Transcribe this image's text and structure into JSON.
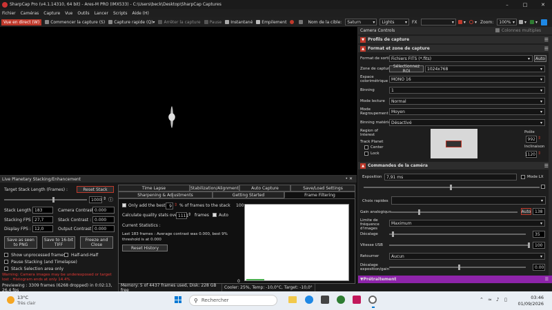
{
  "window": {
    "title": "SharpCap Pro (v4.1.14310, 64 bit) - Ares-M PRO (IMX533) - C:\\Users\\beck\\Desktop\\SharpCap Captures"
  },
  "menu": [
    "Fichier",
    "Caméras",
    "Capture",
    "Vue",
    "Outils",
    "Lancer",
    "Scripts",
    "Aide (H)"
  ],
  "toolbar": {
    "live": "Vue en direct (W)",
    "start_capture": "Commencer la capture (S)",
    "quick_capture": "Capture rapide (Q)",
    "stop_capture": "Arrêter la capture",
    "pause": "Pause",
    "snapshot": "Instantané",
    "stacking": "Empilement",
    "target_label": "Nom de la cible:",
    "target_value": "Saturn",
    "preset_value": "Lights",
    "fx_label": "FX",
    "zoom_label": "Zoom:",
    "zoom_value": "100%"
  },
  "lps": {
    "title": "Live Planetary Stacking/Enhancement",
    "target_stack_label": "Target Stack Length (Frames) :",
    "reset_stack": "Reset Stack",
    "target_stack_value": "1000",
    "stack_length_label": "Stack Length :",
    "stack_length_value": "183",
    "stacking_fps_label": "Stacking FPS :",
    "stacking_fps_value": "27,7",
    "display_fps_label": "Display FPS :",
    "display_fps_value": "12,0",
    "camera_contrast_label": "Camera Contrast :",
    "camera_contrast_value": "0.000",
    "stack_contrast_label": "Stack Contrast :",
    "stack_contrast_value": "0.000",
    "output_contrast_label": "Output Contrast :",
    "output_contrast_value": "0.000",
    "save_png": "Save as seen to PNG",
    "save_tiff": "Save to 16-bit TIFF",
    "freeze_close": "Freeze and Close",
    "show_unprocessed": "Show unprocessed frames",
    "half_and_half": "Half-and-Half",
    "pause_stacking": "Pause Stacking (and Timelapse)",
    "stack_selection": "Stack Selection area only",
    "warning": "Warning: Camera images may be underexposed or target lost - Histogram ends at only 14.4%",
    "tabs_row1": [
      "Time Lapse",
      "Stabilization/Alignment",
      "Auto Capture",
      "Save/Load Settings"
    ],
    "tabs_row2": [
      "Sharpening & Adjustments",
      "Getting Started",
      "Frame Filtering"
    ],
    "only_add_best": "Only add the best",
    "only_add_best_value": "9",
    "percent_frames": "% of frames to the stack",
    "calc_quality": "Calculate quality stats over",
    "calc_quality_value": "1111",
    "frames_label": "frames",
    "auto_label": "Auto",
    "current_stats": "Current Statistics :",
    "stats_text": "Last 183 frames : Average contrast was 0.000, best 9% threshold is at 0.000",
    "reset_history": "Reset History",
    "chart_y_top": "100",
    "chart_y_bottom": "0"
  },
  "statusbar": [
    "Previewing : 3309 frames (6268 dropped) in 0:02:13, 26,4 fps",
    "Memory: 5 of 4437 frames used, Disk: 228 GB free",
    "Cooler: 25%, Temp: -10,0°C, Target: -10,0°"
  ],
  "right": {
    "panel_title": "Camera Controls",
    "multi_columns": "Colonnes multiples",
    "profiles": "Profils de capture",
    "format_section": "Format et zone de capture",
    "output_format_label": "Format de sortie",
    "output_format_value": "Fichiers FITS (*.fits)",
    "auto": "Auto",
    "capture_zone_label": "Zone de capture",
    "capture_zone_button": "Sélectionnez ROI",
    "capture_zone_value": "1024x768",
    "colour_space_label": "Espace colorimétrique",
    "colour_space_value": "MONO 16",
    "binning_label": "Binning",
    "binning_value": "1",
    "read_mode_label": "Mode lecture",
    "read_mode_value": "Normal",
    "grouping_label": "Mode Regroupement",
    "grouping_value": "Moyen",
    "hw_binning_label": "Binning matériel",
    "hw_binning_value": "Désactivé",
    "roi_label": "Region of Interest",
    "track_planet": "Track Planet",
    "center": "Center",
    "lock": "Lock",
    "pole_label": "Poôle",
    "pole_value": "992",
    "incline_label": "Inclinaison",
    "incline_value": "1120",
    "camera_section": "Commandes de la caméra",
    "exposure_label": "Exposition",
    "exposure_value": "7,91 ms",
    "lx_mode": "Mode LX",
    "quick_choices": "Choix rapides",
    "gain_label": "Gain analogique",
    "gain_value": "138",
    "frame_rate_label": "Limite de fréquence d'images",
    "frame_rate_value": "Maximum",
    "offset_label": "Décalage",
    "offset_value": "35",
    "usb_label": "Vitesse USB",
    "usb_value": "100",
    "flip_label": "Retourner",
    "flip_value": "Aucun",
    "exp_offset_label": "Décalage exposition/gain",
    "exp_offset_value": "0.00",
    "preprocessing": "Prétraitement"
  },
  "taskbar": {
    "weather_temp": "13°C",
    "weather_desc": "Très clair",
    "search_placeholder": "Rechercher",
    "time": "03:46",
    "date": "01/09/2026"
  }
}
